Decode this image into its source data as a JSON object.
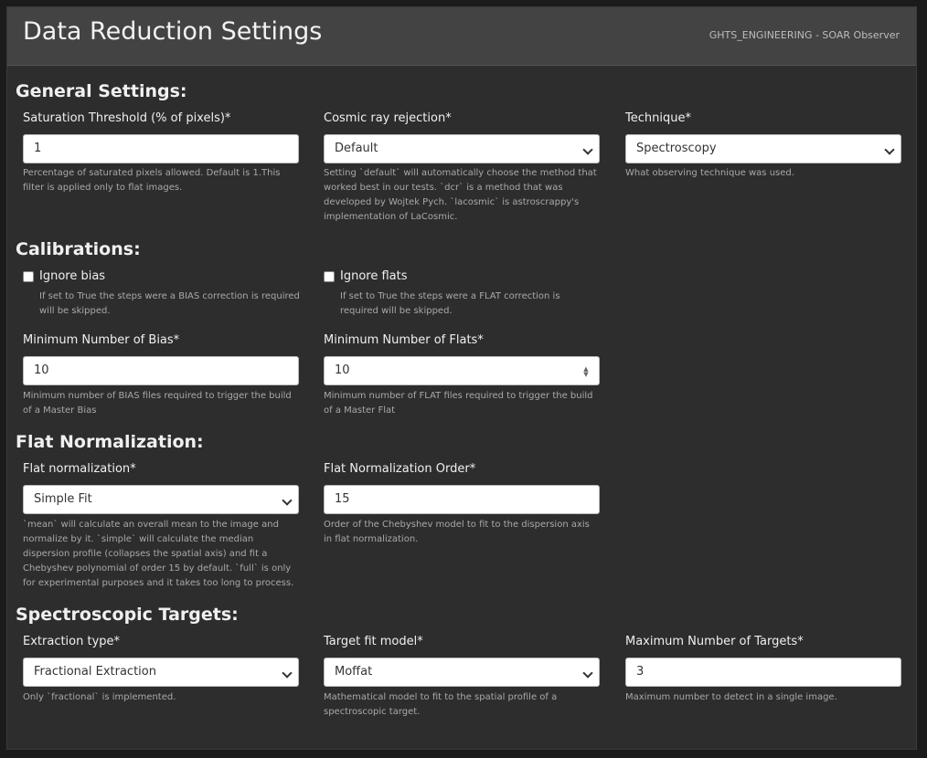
{
  "header": {
    "title": "Data Reduction Settings",
    "user": "GHTS_ENGINEERING - SOAR Observer"
  },
  "general": {
    "title": "General Settings:",
    "saturation": {
      "label": "Saturation Threshold (% of pixels)*",
      "value": "1",
      "help": "Percentage of saturated pixels allowed. Default is 1.This filter is applied only to flat images."
    },
    "cosmic": {
      "label": "Cosmic ray rejection*",
      "value": "Default",
      "help": "Setting `default` will automatically choose the method that worked best in our tests. `dcr` is a method that was developed by Wojtek Pych. `lacosmic` is astroscrappy's implementation of LaCosmic."
    },
    "technique": {
      "label": "Technique*",
      "value": "Spectroscopy",
      "help": "What observing technique was used."
    }
  },
  "calibrations": {
    "title": "Calibrations:",
    "ignore_bias": {
      "label": "Ignore bias",
      "checked": false,
      "help": "If set to True the steps were a BIAS correction is required will be skipped."
    },
    "ignore_flats": {
      "label": "Ignore flats",
      "checked": false,
      "help": "If set to True the steps were a FLAT correction is required will be skipped."
    },
    "min_bias": {
      "label": "Minimum Number of Bias*",
      "value": "10",
      "help": "Minimum number of BIAS files required to trigger the build of a Master Bias"
    },
    "min_flats": {
      "label": "Minimum Number of Flats*",
      "value": "10",
      "help": "Minimum number of FLAT files required to trigger the build of a Master Flat"
    }
  },
  "flat_norm": {
    "title": "Flat Normalization:",
    "method": {
      "label": "Flat normalization*",
      "value": "Simple Fit",
      "help": "`mean` will calculate an overall mean to the image and normalize by it. `simple` will calculate the median dispersion profile (collapses the spatial axis) and fit a Chebyshev polynomial of order 15 by default. `full` is only for experimental purposes and it takes too long to process."
    },
    "order": {
      "label": "Flat Normalization Order*",
      "value": "15",
      "help": "Order of the Chebyshev model to fit to the dispersion axis in flat normalization."
    }
  },
  "spectro": {
    "title": "Spectroscopic Targets:",
    "extraction": {
      "label": "Extraction type*",
      "value": "Fractional Extraction",
      "help": "Only `fractional` is implemented."
    },
    "fit_model": {
      "label": "Target fit model*",
      "value": "Moffat",
      "help": "Mathematical model to fit to the spatial profile of a spectroscopic target."
    },
    "max_targets": {
      "label": "Maximum Number of Targets*",
      "value": "3",
      "help": "Maximum number to detect in a single image."
    }
  }
}
